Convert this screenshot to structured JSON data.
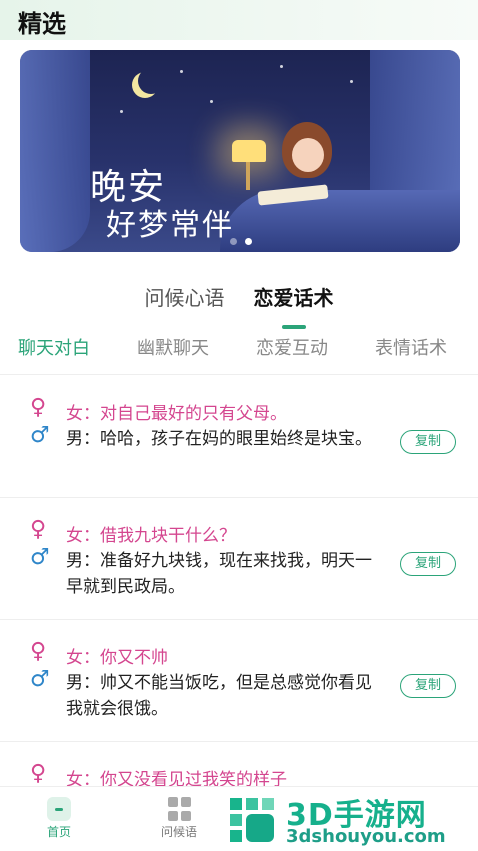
{
  "header": {
    "title": "精选"
  },
  "banner": {
    "line1": "晚安",
    "line2": "好梦常伴"
  },
  "main_tabs": [
    {
      "label": "问候心语",
      "active": false
    },
    {
      "label": "恋爱话术",
      "active": true
    }
  ],
  "sub_tabs": [
    {
      "label": "聊天对白",
      "active": true
    },
    {
      "label": "幽默聊天",
      "active": false
    },
    {
      "label": "恋爱互动",
      "active": false
    },
    {
      "label": "表情话术",
      "active": false
    }
  ],
  "cards": [
    {
      "female": "女：对自己最好的只有父母。",
      "male": "男：哈哈，孩子在妈的眼里始终是块宝。",
      "copy": "复制"
    },
    {
      "female": "女：借我九块干什么？",
      "male": "男：准备好九块钱，现在来找我，明天一早就到民政局。",
      "copy": "复制"
    },
    {
      "female": "女：你又不帅",
      "male": "男：帅又不能当饭吃，但是总感觉你看见我就会很饿。",
      "copy": "复制"
    },
    {
      "female": "女：你又没看见过我笑的样子",
      "male": "",
      "copy": ""
    }
  ],
  "bottom_nav": [
    {
      "label": "首页",
      "active": true
    },
    {
      "label": "问候语",
      "active": false
    }
  ],
  "watermark": {
    "text": "3D手游网",
    "url": "3dshouyou.com"
  },
  "colors": {
    "accent": "#2ba479",
    "female": "#d4468f",
    "male": "#2f86c9"
  }
}
